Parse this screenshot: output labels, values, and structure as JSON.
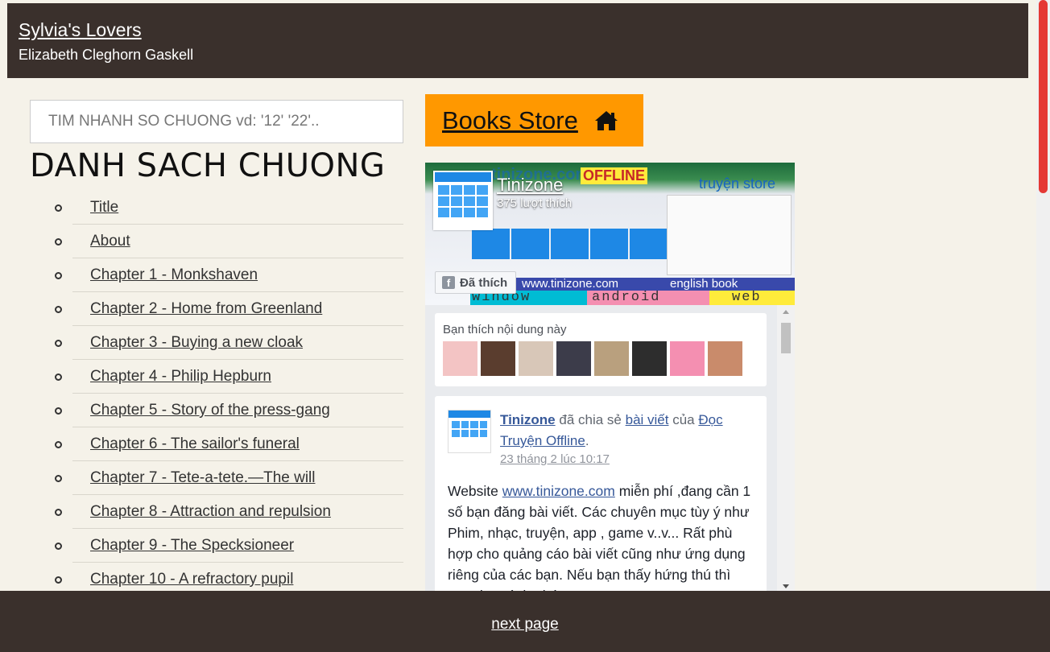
{
  "header": {
    "book_title": "Sylvia's Lovers",
    "author": "Elizabeth Cleghorn Gaskell"
  },
  "search": {
    "placeholder": "TIM NHANH SO CHUONG vd: '12' '22'.."
  },
  "chapter_list": {
    "heading": "DANH SACH CHUONG",
    "items": [
      "Title",
      "About",
      "Chapter 1 - Monkshaven",
      "Chapter 2 - Home from Greenland",
      "Chapter 3 - Buying a new cloak",
      "Chapter 4 - Philip Hepburn",
      "Chapter 5 - Story of the press-gang",
      "Chapter 6 - The sailor's funeral",
      "Chapter 7 - Tete-a-tete.—The will",
      "Chapter 8 - Attraction and repulsion",
      "Chapter 9 - The Specksioneer",
      "Chapter 10 - A refractory pupil"
    ]
  },
  "store_button": {
    "label": "Books Store",
    "icon": "home-icon",
    "color": "#ff9800"
  },
  "fb_widget": {
    "cover": {
      "banner_text": "tinizone.com",
      "offline_text": "OFFLINE",
      "store_text": "truyện store",
      "strip_site": "www.tinizone.com",
      "strip_english": "english book",
      "strip_window": "window",
      "strip_android": "android",
      "strip_web": "web"
    },
    "page_name": "Tinizone",
    "page_likes": "375 lượt thích",
    "like_button": "Đã thích",
    "friends_label": "Bạn thích nội dung này",
    "friend_avatar_colors": [
      "#f3c4c4",
      "#5a3d2e",
      "#d8c7b8",
      "#3c3c4a",
      "#b9a07e",
      "#2d2d2d",
      "#f48fb1",
      "#c98b6b"
    ],
    "post": {
      "page": "Tinizone",
      "shared_text": "đã chia sẻ",
      "post_link": "bài viết",
      "of_text": "của",
      "source_page": "Đọc Truyện Offline",
      "time": "23 tháng 2 lúc 10:17",
      "body_prefix": "Website",
      "body_url": "www.tinizone.com",
      "body_rest": "miễn phí ,đang cần 1 số bạn đăng bài viết. Các chuyên mục tùy ý như Phim, nhạc, truyện, app , game v..v... Rất phù hợp cho quảng cáo bài viết cũng như ứng dụng riêng của các bạn. Nếu bạn thấy hứng thú thì PM cho mình nhé."
    }
  },
  "footer": {
    "next_label": "next page"
  },
  "colors": {
    "header_bg": "#3a302c",
    "page_bg": "#f5f2e9",
    "scrollbar_thumb": "#e53935",
    "fb_link": "#365899"
  }
}
